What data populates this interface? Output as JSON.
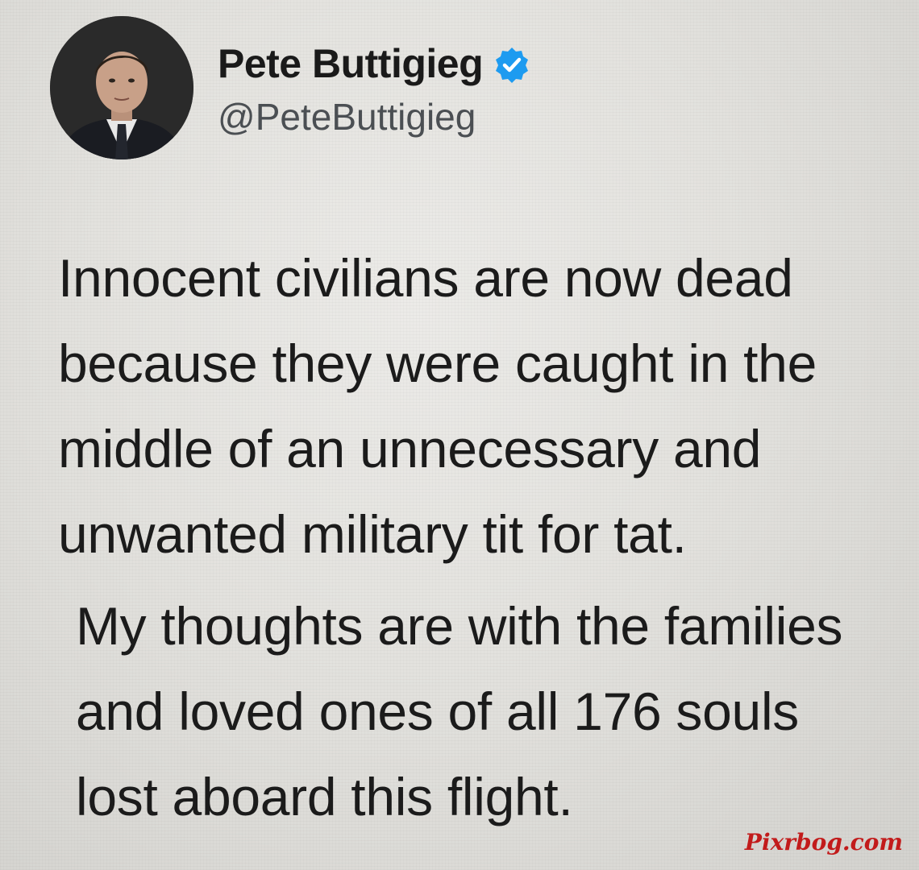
{
  "tweet": {
    "author": {
      "name": "Pete Buttigieg",
      "handle": "@PeteButtigieg",
      "verified": true,
      "avatar_icon": "profile-photo"
    },
    "paragraphs": [
      "Innocent civilians are now dead because they were caught in the middle of an unnecessary and unwanted military tit for tat.",
      "My thoughts are with the families and loved ones of all 176 souls lost aboard this flight."
    ]
  },
  "watermark": "Pixrbog.com",
  "colors": {
    "verified_badge": "#1d9bf0",
    "text": "#1b1b1b",
    "handle": "#4b4f53",
    "watermark": "#c21b1b"
  }
}
